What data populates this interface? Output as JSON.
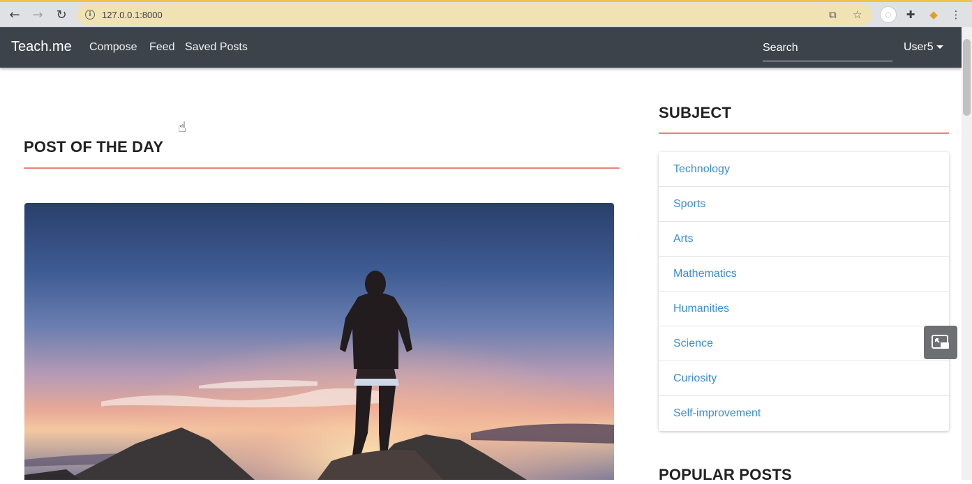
{
  "browser": {
    "url": "127.0.0.1:8000",
    "back_icon": "back-arrow-icon",
    "forward_icon": "forward-arrow-icon",
    "reload_icon": "reload-icon",
    "info_icon": "info-icon",
    "translate_icon": "translate-icon",
    "bookmark_icon": "star-icon",
    "extensions_icon": "puzzle-icon",
    "menu_icon": "kebab-menu-icon"
  },
  "navbar": {
    "brand": "Teach.me",
    "links": [
      "Compose",
      "Feed",
      "Saved Posts"
    ],
    "search_placeholder": "Search",
    "user": "User5"
  },
  "main": {
    "post_of_the_day_title": "POST OF THE DAY"
  },
  "sidebar": {
    "subject_title": "SUBJECT",
    "subjects": [
      "Technology",
      "Sports",
      "Arts",
      "Mathematics",
      "Humanities",
      "Science",
      "Curiosity",
      "Self-improvement"
    ],
    "popular_posts_title": "POPULAR POSTS"
  },
  "colors": {
    "navbar_bg": "#3c434b",
    "accent_rule": "#e8827a",
    "link_blue": "#3d8bd6"
  }
}
